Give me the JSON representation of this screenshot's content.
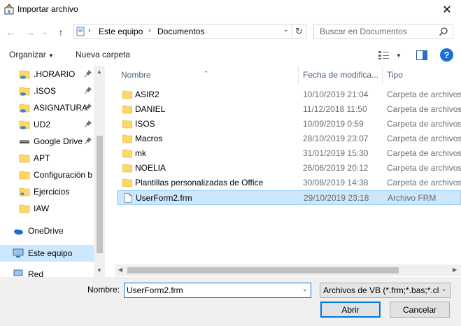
{
  "window": {
    "title": "Importar archivo"
  },
  "address": {
    "crumbs": [
      "Este equipo",
      "Documentos"
    ]
  },
  "search": {
    "placeholder": "Buscar en Documentos"
  },
  "toolbar": {
    "organize": "Organizar",
    "new_folder": "Nueva carpeta"
  },
  "sidebar": {
    "items": [
      {
        "label": ".HORARIO",
        "icon": "folder-cloud-icon",
        "pinned": true
      },
      {
        "label": ".ISOS",
        "icon": "folder-cloud-icon",
        "pinned": true
      },
      {
        "label": "ASIGNATURA",
        "icon": "folder-cloud-icon",
        "pinned": true
      },
      {
        "label": "UD2",
        "icon": "folder-cloud-icon",
        "pinned": true
      },
      {
        "label": "Google Drive",
        "icon": "drive-icon",
        "pinned": true
      },
      {
        "label": "APT",
        "icon": "folder-icon",
        "pinned": false
      },
      {
        "label": "Configuración b",
        "icon": "folder-icon",
        "pinned": false
      },
      {
        "label": "Ejercicios",
        "icon": "folder-star-icon",
        "pinned": false
      },
      {
        "label": "IAW",
        "icon": "folder-icon",
        "pinned": false
      }
    ],
    "onedrive": "OneDrive",
    "this_pc": "Este equipo",
    "network": "Red"
  },
  "columns": {
    "name": "Nombre",
    "date": "Fecha de modifica...",
    "type": "Tipo"
  },
  "files": [
    {
      "name": "ASIR2",
      "date": "10/10/2019 21:04",
      "type": "Carpeta de archivos",
      "kind": "folder"
    },
    {
      "name": "DANIEL",
      "date": "11/12/2018 11:50",
      "type": "Carpeta de archivos",
      "kind": "folder"
    },
    {
      "name": "ISOS",
      "date": "10/09/2019 0:59",
      "type": "Carpeta de archivos",
      "kind": "folder"
    },
    {
      "name": "Macros",
      "date": "28/10/2019 23:07",
      "type": "Carpeta de archivos",
      "kind": "folder"
    },
    {
      "name": "mk",
      "date": "31/01/2019 15:30",
      "type": "Carpeta de archivos",
      "kind": "folder"
    },
    {
      "name": "NOELIA",
      "date": "26/06/2019 20:12",
      "type": "Carpeta de archivos",
      "kind": "folder"
    },
    {
      "name": "Plantillas personalizadas de Office",
      "date": "30/08/2019 14:38",
      "type": "Carpeta de archivos",
      "kind": "folder"
    },
    {
      "name": "UserForm2.frm",
      "date": "29/10/2019 23:18",
      "type": "Archivo FRM",
      "kind": "file",
      "selected": true
    }
  ],
  "bottom": {
    "filename_label": "Nombre:",
    "filename_value": "UserForm2.frm",
    "filetype_value": "Archivos de VB (*.frm;*.bas;*.cls)",
    "open_label": "Abrir",
    "cancel_label": "Cancelar"
  },
  "colors": {
    "accent": "#0078d7",
    "selection": "#cce8ff",
    "folder": "#ffd767"
  }
}
